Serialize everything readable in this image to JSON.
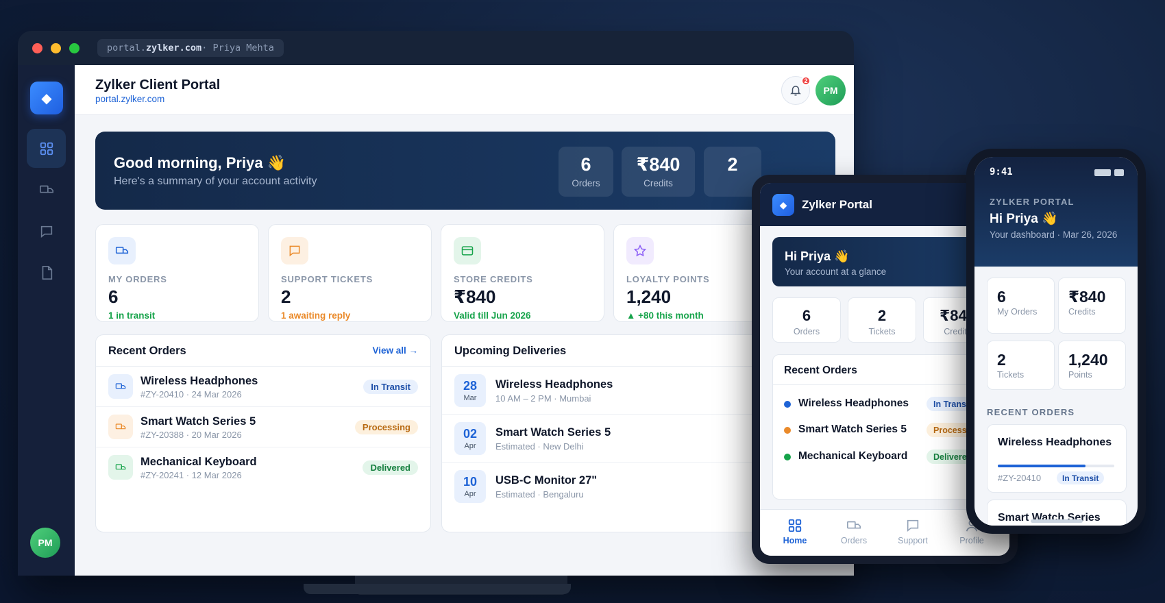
{
  "browser": {
    "url_prefix": "portal.",
    "url_domain": "zylker.com",
    "url_suffix": " · Priya Mehta"
  },
  "sidebar": {
    "avatar": "PM"
  },
  "header": {
    "title": "Zylker Client Portal",
    "subtitle": "portal.zylker.com",
    "notifications": "2",
    "avatar": "PM"
  },
  "hero": {
    "greeting": "Good morning, Priya 👋",
    "subtitle": "Here's a summary of your account activity",
    "stats": [
      {
        "value": "6",
        "label": "Orders"
      },
      {
        "value": "₹840",
        "label": "Credits"
      },
      {
        "value": "2",
        "label": ""
      }
    ]
  },
  "stat_cards": [
    {
      "label": "MY ORDERS",
      "value": "6",
      "sub": "1 in transit",
      "icon": "truck-icon",
      "color": "#1e63d6"
    },
    {
      "label": "SUPPORT TICKETS",
      "value": "2",
      "sub": "1 awaiting reply",
      "icon": "chat-icon",
      "color": "#ea8a2a"
    },
    {
      "label": "STORE CREDITS",
      "value": "₹840",
      "sub": "Valid till Jun 2026",
      "icon": "card-icon",
      "color": "#16a34a"
    },
    {
      "label": "LOYALTY POINTS",
      "value": "1,240",
      "sub": "▲ +80 this month",
      "icon": "star-icon",
      "color": "#8b5cf6"
    }
  ],
  "recent_orders": {
    "title": "Recent Orders",
    "view_all": "View all →",
    "rows": [
      {
        "name": "Wireless Headphones",
        "meta": "#ZY-20410 · 24 Mar 2026",
        "status": "In Transit"
      },
      {
        "name": "Smart Watch Series 5",
        "meta": "#ZY-20388 · 20 Mar 2026",
        "status": "Processing"
      },
      {
        "name": "Mechanical Keyboard",
        "meta": "#ZY-20241 · 12 Mar 2026",
        "status": "Delivered"
      }
    ]
  },
  "deliveries": {
    "title": "Upcoming Deliveries",
    "rows": [
      {
        "day": "28",
        "month": "Mar",
        "name": "Wireless Headphones",
        "meta": "10 AM – 2 PM · Mumbai"
      },
      {
        "day": "02",
        "month": "Apr",
        "name": "Smart Watch Series 5",
        "meta": "Estimated · New Delhi"
      },
      {
        "day": "10",
        "month": "Apr",
        "name": "USB-C Monitor 27\"",
        "meta": "Estimated · Bengaluru"
      }
    ]
  },
  "tablet": {
    "title": "Zylker Portal",
    "hero_title": "Hi Priya 👋",
    "hero_sub": "Your account at a glance",
    "stats": [
      {
        "value": "6",
        "label": "Orders"
      },
      {
        "value": "2",
        "label": "Tickets"
      },
      {
        "value": "₹840",
        "label": "Credits"
      }
    ],
    "orders_title": "Recent Orders",
    "orders": [
      {
        "name": "Wireless Headphones",
        "status": "In Transit"
      },
      {
        "name": "Smart Watch Series 5",
        "status": "Processing"
      },
      {
        "name": "Mechanical Keyboard",
        "status": "Delivered"
      }
    ],
    "tabs": [
      "Home",
      "Orders",
      "Support",
      "Profile"
    ]
  },
  "phone": {
    "time": "9:41",
    "label": "ZYLKER PORTAL",
    "title": "Hi Priya 👋",
    "subtitle": "Your dashboard · Mar 26, 2026",
    "stats": [
      {
        "value": "6",
        "label": "My Orders"
      },
      {
        "value": "₹840",
        "label": "Credits"
      },
      {
        "value": "2",
        "label": "Tickets"
      },
      {
        "value": "1,240",
        "label": "Points"
      }
    ],
    "section": "RECENT ORDERS",
    "order1": {
      "name": "Wireless Headphones",
      "meta": "#ZY-20410",
      "status": "In Transit",
      "progress": 0.75
    },
    "order2": {
      "name": "Smart Watch Series"
    }
  },
  "colors": {
    "accent": "#1e63d6",
    "transit_bg": "#e8f0fd",
    "transit_fg": "#1e4fa8",
    "processing_bg": "#fdf0dd",
    "processing_fg": "#b86a12",
    "delivered_bg": "#e3f5ea",
    "delivered_fg": "#16803f"
  }
}
